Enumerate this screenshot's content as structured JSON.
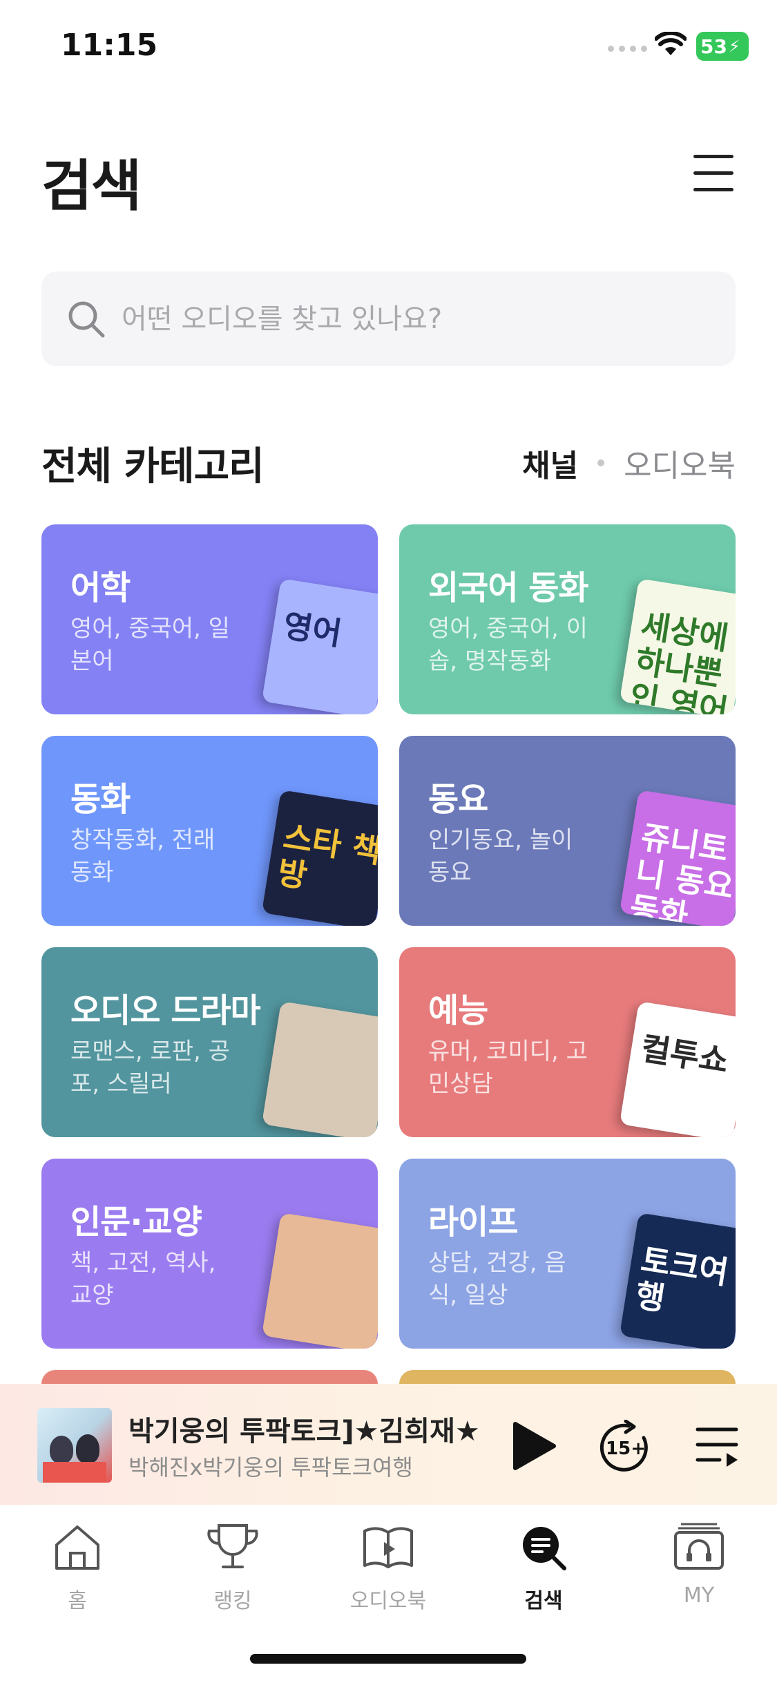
{
  "status_bar": {
    "time": "11:15",
    "battery": "53"
  },
  "header": {
    "title": "검색"
  },
  "search": {
    "placeholder": "어떤 오디오를 찾고 있나요?"
  },
  "categories_section": {
    "title": "전체 카테고리",
    "toggle_active": "채널",
    "toggle_inactive": "오디오북"
  },
  "categories": [
    {
      "title": "어학",
      "subtitle": "영어, 중국어, 일본어",
      "color": "#8381f4",
      "thumb_text": "영어",
      "thumb_color": "#a9b4ff"
    },
    {
      "title": "외국어 동화",
      "subtitle": "영어, 중국어, 이솝, 명작동화",
      "color": "#6ecaab",
      "thumb_text": "세상에 하나뿐인 영어동화",
      "thumb_color": "#f5f8e6"
    },
    {
      "title": "동화",
      "subtitle": "창작동화, 전래동화",
      "color": "#6f96fb",
      "thumb_text": "스타 책방",
      "thumb_color": "#1b2240"
    },
    {
      "title": "동요",
      "subtitle": "인기동요, 놀이동요",
      "color": "#6b79b9",
      "thumb_text": "쥬니토니 동요동화",
      "thumb_color": "#c86ee6"
    },
    {
      "title": "오디오 드라마",
      "subtitle": "로맨스, 로판, 공포, 스릴러",
      "color": "#52959e",
      "thumb_text": "",
      "thumb_color": "#d8c9b7"
    },
    {
      "title": "예능",
      "subtitle": "유머, 코미디, 고민상담",
      "color": "#e77b7c",
      "thumb_text": "컬투쇼",
      "thumb_color": "#ffffff"
    },
    {
      "title": "인문·교양",
      "subtitle": "책, 고전, 역사, 교양",
      "color": "#9b7cf0",
      "thumb_text": "",
      "thumb_color": "#e7b996"
    },
    {
      "title": "라이프",
      "subtitle": "상담, 건강, 음식, 일상",
      "color": "#8ca3e4",
      "thumb_text": "토크여행",
      "thumb_color": "#152a55"
    }
  ],
  "partial_row_colors": [
    "#e8857a",
    "#e0b561"
  ],
  "player": {
    "title": "박기웅의 투팍토크]★김희재★",
    "subtitle": "박해진x박기웅의 투팍토크여행"
  },
  "tabbar": {
    "items": [
      {
        "label": "홈",
        "icon": "home-icon"
      },
      {
        "label": "랭킹",
        "icon": "trophy-icon"
      },
      {
        "label": "오디오북",
        "icon": "audiobook-icon"
      },
      {
        "label": "검색",
        "icon": "search-icon"
      },
      {
        "label": "MY",
        "icon": "headphones-icon"
      }
    ],
    "active": "검색"
  }
}
